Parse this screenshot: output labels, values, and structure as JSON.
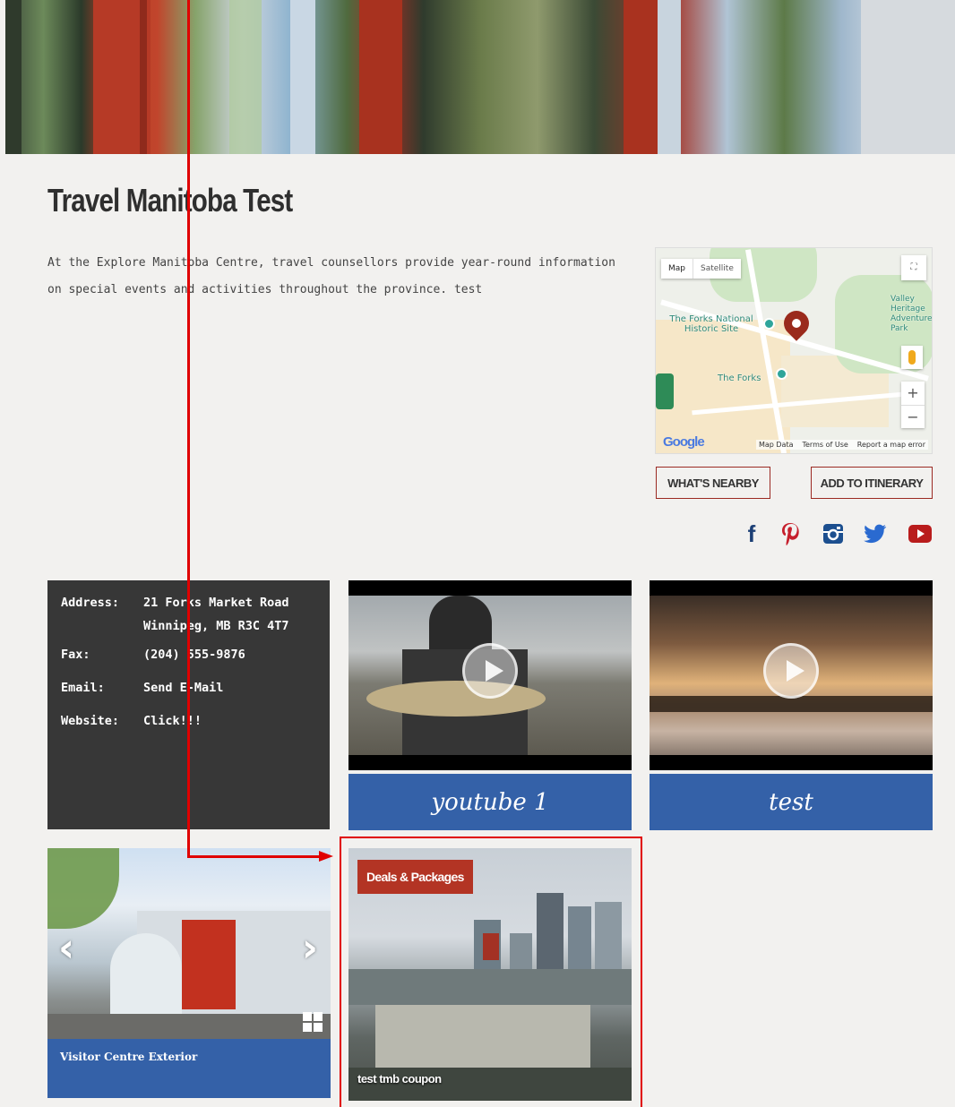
{
  "page": {
    "title": "Travel Manitoba Test",
    "description": "At the Explore Manitoba Centre, travel counsellors provide year-round information on special events and activities throughout the province. test"
  },
  "map": {
    "type_buttons": [
      "Map",
      "Satellite"
    ],
    "labels": {
      "forks_historic": "The Forks National Historic Site",
      "forks": "The Forks",
      "park": "Valley Heritage Adventure Park"
    },
    "attribution": "Google",
    "footer": [
      "Map Data",
      "Terms of Use",
      "Report a map error"
    ],
    "zoom": [
      "+",
      "−"
    ],
    "fullscreen_icon": "fullscreen-icon"
  },
  "actions": {
    "nearby": "WHAT'S NEARBY",
    "itinerary": "ADD TO ITINERARY"
  },
  "social": [
    {
      "name": "facebook-icon",
      "glyph": "f",
      "color": "#1c3f75"
    },
    {
      "name": "pinterest-icon",
      "glyph": "P",
      "color": "#c61f2c"
    },
    {
      "name": "instagram-icon",
      "glyph": "◘",
      "color": "#1c4f8f"
    },
    {
      "name": "twitter-icon",
      "glyph": "t",
      "color": "#2a6ad0"
    },
    {
      "name": "youtube-icon",
      "glyph": "▶",
      "color": "#b91c1c"
    }
  ],
  "contact": {
    "address_label": "Address:",
    "address_line1": "21 Forks Market Road",
    "address_line2": "Winnipeg, MB R3C 4T7",
    "fax_label": "Fax:",
    "fax": "(204) 555-9876",
    "email_label": "Email:",
    "email": "Send E-Mail",
    "website_label": "Website:",
    "website": "Click!!!"
  },
  "videos": [
    {
      "title": "youtube 1"
    },
    {
      "title": "test"
    }
  ],
  "gallery": {
    "caption": "Visitor Centre Exterior",
    "prev": "‹",
    "next": "›"
  },
  "deal": {
    "badge": "Deals & Packages",
    "title": "test tmb coupon"
  },
  "colors": {
    "accent_blue": "#3461a8",
    "accent_red": "#b33424",
    "annotation_red": "#e00000"
  }
}
